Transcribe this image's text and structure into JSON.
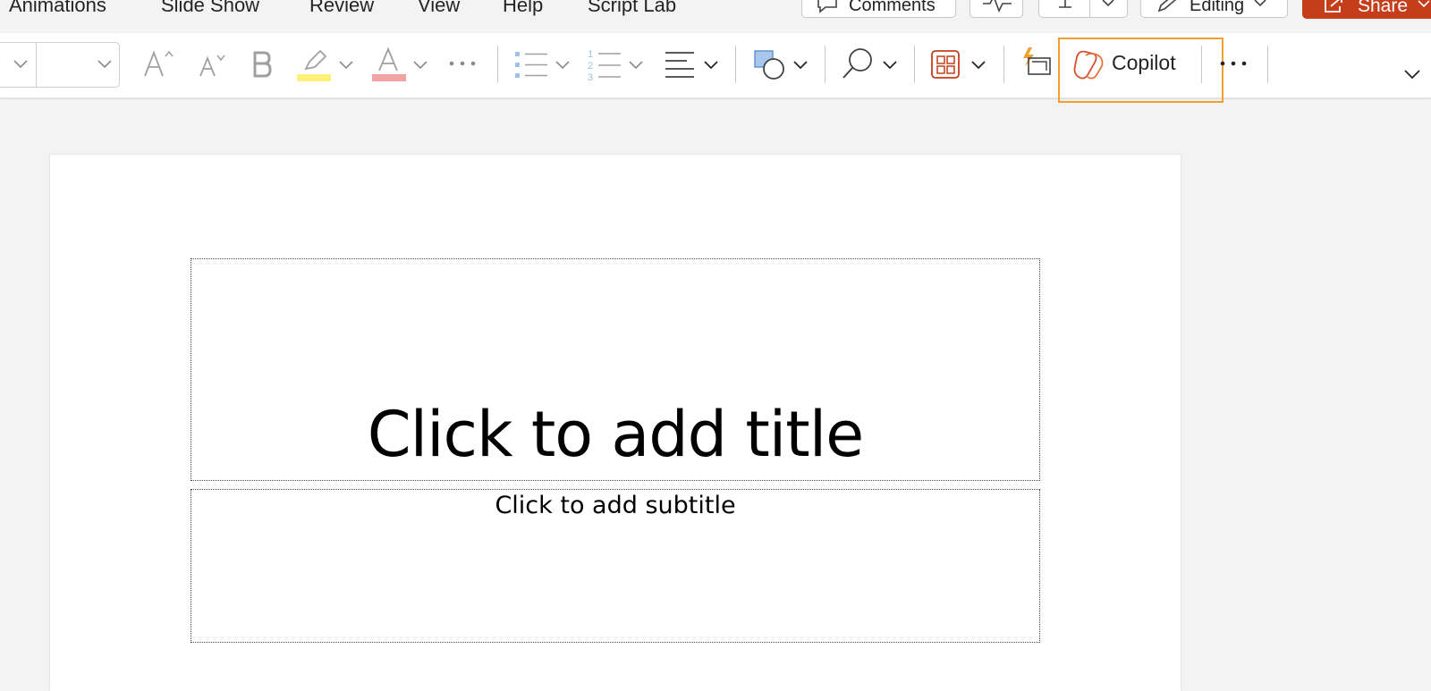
{
  "menu": {
    "tabs": [
      "Animations",
      "Slide Show",
      "Review",
      "View",
      "Help",
      "Script Lab"
    ]
  },
  "header": {
    "comments_label": "Comments",
    "editing_label": "Editing",
    "share_label": "Share"
  },
  "ribbon": {
    "font_size_value": "",
    "copilot_label": "Copilot",
    "icons": [
      "font-name-dropdown",
      "font-size-dropdown",
      "increase-font-size-icon",
      "decrease-font-size-icon",
      "bold-icon",
      "highlight-icon",
      "font-color-icon",
      "more-font-options-icon",
      "bullets-icon",
      "numbering-icon",
      "align-icon",
      "shapes-icon",
      "find-icon",
      "designer-icon",
      "add-in-icon",
      "copilot-icon",
      "more-options-icon",
      "collapse-ribbon-icon"
    ],
    "highlight_color": "#fff27a",
    "font_color_bar": "#f4a3a3",
    "copilot_outline_color": "#f0a030"
  },
  "slide": {
    "title_placeholder": "Click to add title",
    "subtitle_placeholder": "Click to add subtitle"
  },
  "colors": {
    "share_bg": "#c43e1c",
    "app_bg": "#f3f3f3"
  }
}
